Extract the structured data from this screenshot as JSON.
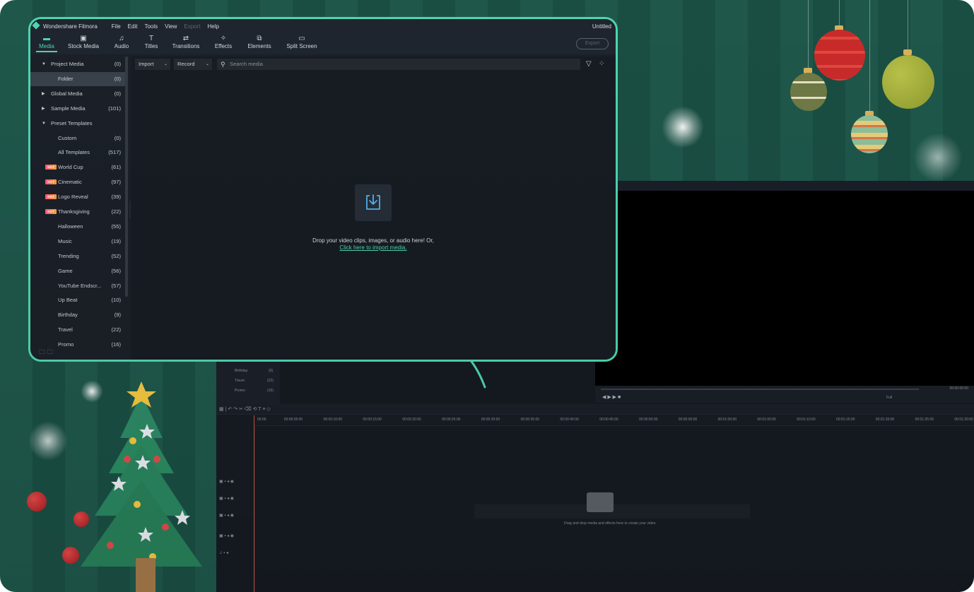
{
  "app": {
    "name": "Wondershare Filmora",
    "title": "Untitled"
  },
  "menu": [
    "File",
    "Edit",
    "Tools",
    "View",
    "Export",
    "Help"
  ],
  "tabs": [
    {
      "label": "Media",
      "icon": "folder-icon",
      "active": true
    },
    {
      "label": "Stock Media",
      "icon": "stock-media-icon"
    },
    {
      "label": "Audio",
      "icon": "music-note-icon"
    },
    {
      "label": "Titles",
      "icon": "text-icon"
    },
    {
      "label": "Transitions",
      "icon": "transitions-icon"
    },
    {
      "label": "Effects",
      "icon": "sparkle-icon"
    },
    {
      "label": "Elements",
      "icon": "elements-icon"
    },
    {
      "label": "Split Screen",
      "icon": "split-screen-icon"
    }
  ],
  "export_label": "Export",
  "sidebar": [
    {
      "label": "Project Media",
      "count": "(0)",
      "arrow": "▼",
      "level": 0
    },
    {
      "label": "Folder",
      "count": "(0)",
      "level": 1,
      "selected": true
    },
    {
      "label": "Global Media",
      "count": "(0)",
      "arrow": "▶",
      "level": 0
    },
    {
      "label": "Sample Media",
      "count": "(101)",
      "arrow": "▶",
      "level": 0
    },
    {
      "label": "Preset Templates",
      "count": "",
      "arrow": "▼",
      "level": 0
    },
    {
      "label": "Custom",
      "count": "(0)",
      "level": 1
    },
    {
      "label": "All Templates",
      "count": "(517)",
      "level": 1
    },
    {
      "label": "World Cup",
      "count": "(61)",
      "level": 1,
      "hot": true
    },
    {
      "label": "Cinematic",
      "count": "(97)",
      "level": 1,
      "hot": true
    },
    {
      "label": "Logo Reveal",
      "count": "(39)",
      "level": 1,
      "hot": true
    },
    {
      "label": "Thanksgiving",
      "count": "(22)",
      "level": 1,
      "hot": true
    },
    {
      "label": "Halloween",
      "count": "(55)",
      "level": 1
    },
    {
      "label": "Music",
      "count": "(19)",
      "level": 1
    },
    {
      "label": "Trending",
      "count": "(52)",
      "level": 1
    },
    {
      "label": "Game",
      "count": "(56)",
      "level": 1
    },
    {
      "label": "YouTube Endscr...",
      "count": "(57)",
      "level": 1
    },
    {
      "label": "Up Beat",
      "count": "(10)",
      "level": 1
    },
    {
      "label": "Birthday",
      "count": "(9)",
      "level": 1
    },
    {
      "label": "Travel",
      "count": "(22)",
      "level": 1
    },
    {
      "label": "Promo",
      "count": "(16)",
      "level": 1
    }
  ],
  "hot_badge": "HOT",
  "toolbar": {
    "import": "Import",
    "record": "Record",
    "search_placeholder": "Search media"
  },
  "drop": {
    "text": "Drop your video clips, images, or audio here! Or,",
    "link": "Click here to import media."
  },
  "background_window": {
    "sidebar_items": [
      {
        "label": "Birthday",
        "count": "(9)"
      },
      {
        "label": "Travel",
        "count": "(22)"
      },
      {
        "label": "Promo",
        "count": "(16)"
      }
    ],
    "timecode": "00:00:00:00",
    "quality": "Full",
    "ruler_ticks": [
      "00:00",
      "00:00:05:00",
      "00:00:10:00",
      "00:00:15:00",
      "00:00:20:00",
      "00:00:25:00",
      "00:00:30:00",
      "00:00:35:00",
      "00:00:40:00",
      "00:00:45:00",
      "00:00:50:00",
      "00:00:55:00",
      "00:01:00:00",
      "00:01:05:00",
      "00:01:10:00",
      "00:01:15:00",
      "00:01:20:00",
      "00:01:25:00",
      "00:01:30:00"
    ],
    "timeline_hint": "Drag and drop media and effects here to create your video."
  },
  "colors": {
    "accent": "#4fd4b0",
    "bg_green": "#1f574b",
    "panel": "#1b2028"
  }
}
